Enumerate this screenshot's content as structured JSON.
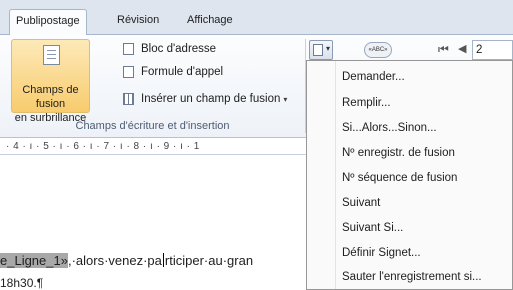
{
  "tabs": [
    {
      "label": "Publipostage",
      "active": true
    },
    {
      "label": "Révision",
      "active": false
    },
    {
      "label": "Affichage",
      "active": false
    }
  ],
  "ribbon": {
    "highlight_button_label_1": "Champs de fusion",
    "highlight_button_label_2": "en surbrillance",
    "address_block": "Bloc d'adresse",
    "greeting_line": "Formule d'appel",
    "insert_merge_field": "Insérer un champ de fusion",
    "group_label": "Champs d'écriture et d'insertion",
    "preview_icon_text": "«ABC»",
    "record_number": "2"
  },
  "ruler": {
    "text": "· 4 · ı · 5 · ı · 6 · ı · 7 · ı · 8 · ı · 9 · ı · 1"
  },
  "document": {
    "field_text": "e_Ligne_1»",
    "line1_before_cursor": ",·alors·venez·pa",
    "line1_after_cursor": "rticiper·au·gran",
    "line2": "18h30.¶"
  },
  "menu": {
    "items": [
      "Demander...",
      "Remplir...",
      "Si...Alors...Sinon...",
      "Nº enregistr. de fusion",
      "Nº séquence de fusion",
      "Suivant",
      "Suivant Si...",
      "Définir Signet...",
      "Sauter l'enregistrement si..."
    ]
  }
}
